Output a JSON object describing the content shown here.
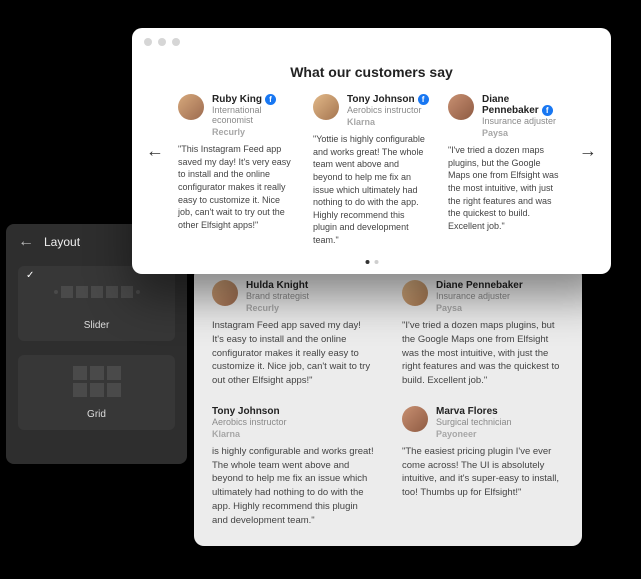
{
  "editor": {
    "title": "Layout",
    "options": [
      {
        "label": "Slider",
        "selected": true
      },
      {
        "label": "Grid",
        "selected": false
      }
    ]
  },
  "slider_preview": {
    "heading": "What our customers say",
    "reviews": [
      {
        "name": "Ruby King",
        "role": "International economist",
        "brand": "Recurly",
        "quote": "\"This Instagram Feed app saved my day! It's very easy to install and the online configurator makes it really easy to customize it. Nice job, can't wait to try out the other Elfsight apps!\""
      },
      {
        "name": "Tony Johnson",
        "role": "Aerobics instructor",
        "brand": "Klarna",
        "quote": "\"Yottie is highly configurable and works great! The whole team went above and beyond to help me fix an issue which ultimately had nothing to do with the app. Highly recommend this plugin and development team.\""
      },
      {
        "name": "Diane Pennebaker",
        "role": "Insurance adjuster",
        "brand": "Paysa",
        "quote": "\"I've tried a dozen maps plugins, but the Google Maps one from Elfsight was the most intuitive, with just the right features and was the quickest to build. Excellent job.\""
      }
    ],
    "active_page": 0,
    "pages": 2
  },
  "grid_preview": {
    "reviews": [
      {
        "name": "Hulda Knight",
        "role": "Brand strategist",
        "brand": "Recurly",
        "quote": "Instagram Feed app saved my day! It's easy to install and the online configurator makes it really easy to customize it. Nice job, can't wait to try out other Elfsight apps!\""
      },
      {
        "name": "Diane Pennebaker",
        "role": "Insurance adjuster",
        "brand": "Paysa",
        "quote": "\"I've tried a dozen maps plugins, but the Google Maps one from Elfsight was the most intuitive, with just the right features and was the quickest to build. Excellent job.\""
      },
      {
        "name": "Tony Johnson",
        "role": "Aerobics instructor",
        "brand": "Klarna",
        "quote": "is highly configurable and works great! The whole team went above and beyond to help me fix an issue which ultimately had nothing to do with the app. Highly recommend this plugin and development team.\""
      },
      {
        "name": "Marva Flores",
        "role": "Surgical technician",
        "brand": "Payoneer",
        "quote": "\"The easiest pricing plugin I've ever come across! The UI is absolutely intuitive, and it's super-easy to install, too! Thumbs up for Elfsight!\""
      }
    ]
  }
}
